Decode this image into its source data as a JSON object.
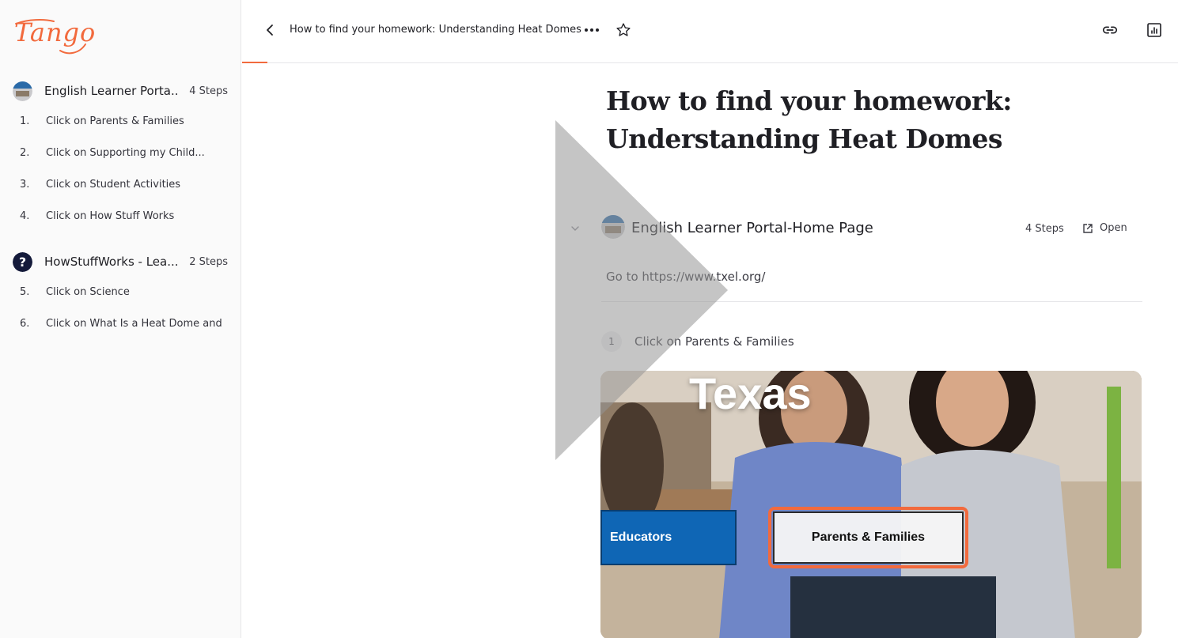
{
  "app": {
    "logo_text": "Tango",
    "accent": "#f26a3d"
  },
  "header": {
    "title": "How to find your homework: Understanding Heat Domes",
    "back_icon": "chevron-left-icon",
    "more_icon": "more-horizontal-icon",
    "star_icon": "star-icon",
    "link_icon": "link-icon",
    "analytics_icon": "analytics-icon"
  },
  "sidebar": {
    "groups": [
      {
        "title": "English Learner Porta...",
        "count": "4 Steps",
        "steps": [
          {
            "num": "1.",
            "label": "Click on Parents & Families"
          },
          {
            "num": "2.",
            "label": "Click on Supporting my Child..."
          },
          {
            "num": "3.",
            "label": "Click on Student Activities"
          },
          {
            "num": "4.",
            "label": "Click on How Stuff Works"
          }
        ]
      },
      {
        "title": "HowStuffWorks - Lea...",
        "count": "2 Steps",
        "steps": [
          {
            "num": "5.",
            "label": "Click on Science"
          },
          {
            "num": "6.",
            "label": "Click on What Is a Heat Dome and"
          }
        ]
      }
    ]
  },
  "main": {
    "title_line1": "How to find your homework:",
    "title_line2": "Understanding Heat Domes",
    "section": {
      "title": "English Learner Portal-Home Page",
      "steps": "4 Steps",
      "open_label": "Open",
      "goto": "Go to https://www.txel.org/"
    },
    "step": {
      "num": "1",
      "text": "Click on Parents & Families"
    },
    "screenshot": {
      "heading": "Texas",
      "educators_label": "Educators",
      "parents_label": "Parents & Families"
    }
  }
}
